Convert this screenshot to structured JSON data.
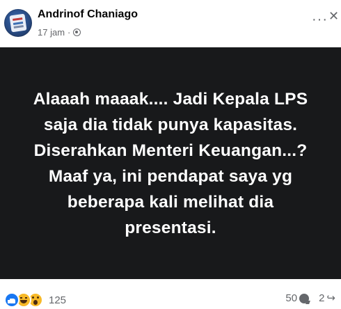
{
  "post": {
    "author": "Andrinof Chaniago",
    "time": "17 jam",
    "separator": "·",
    "audience_icon": "globe-icon",
    "more_icon": "more-icon",
    "close_icon": "close-icon",
    "content_text": "Alaaah maaak.... Jadi Kepala LPS saja dia tidak punya kapasitas. Diserahkan Menteri Keuangan...? Maaf ya, ini pendapat saya yg beberapa kali melihat dia presentasi.",
    "background_color": "#18191b"
  },
  "footer": {
    "reaction_icons": [
      "like-icon",
      "haha-icon",
      "wow-icon"
    ],
    "reaction_count": "125",
    "comment_count": "50",
    "share_count": "2"
  },
  "glyphs": {
    "more": "···",
    "close": "✕",
    "share": "↪"
  }
}
